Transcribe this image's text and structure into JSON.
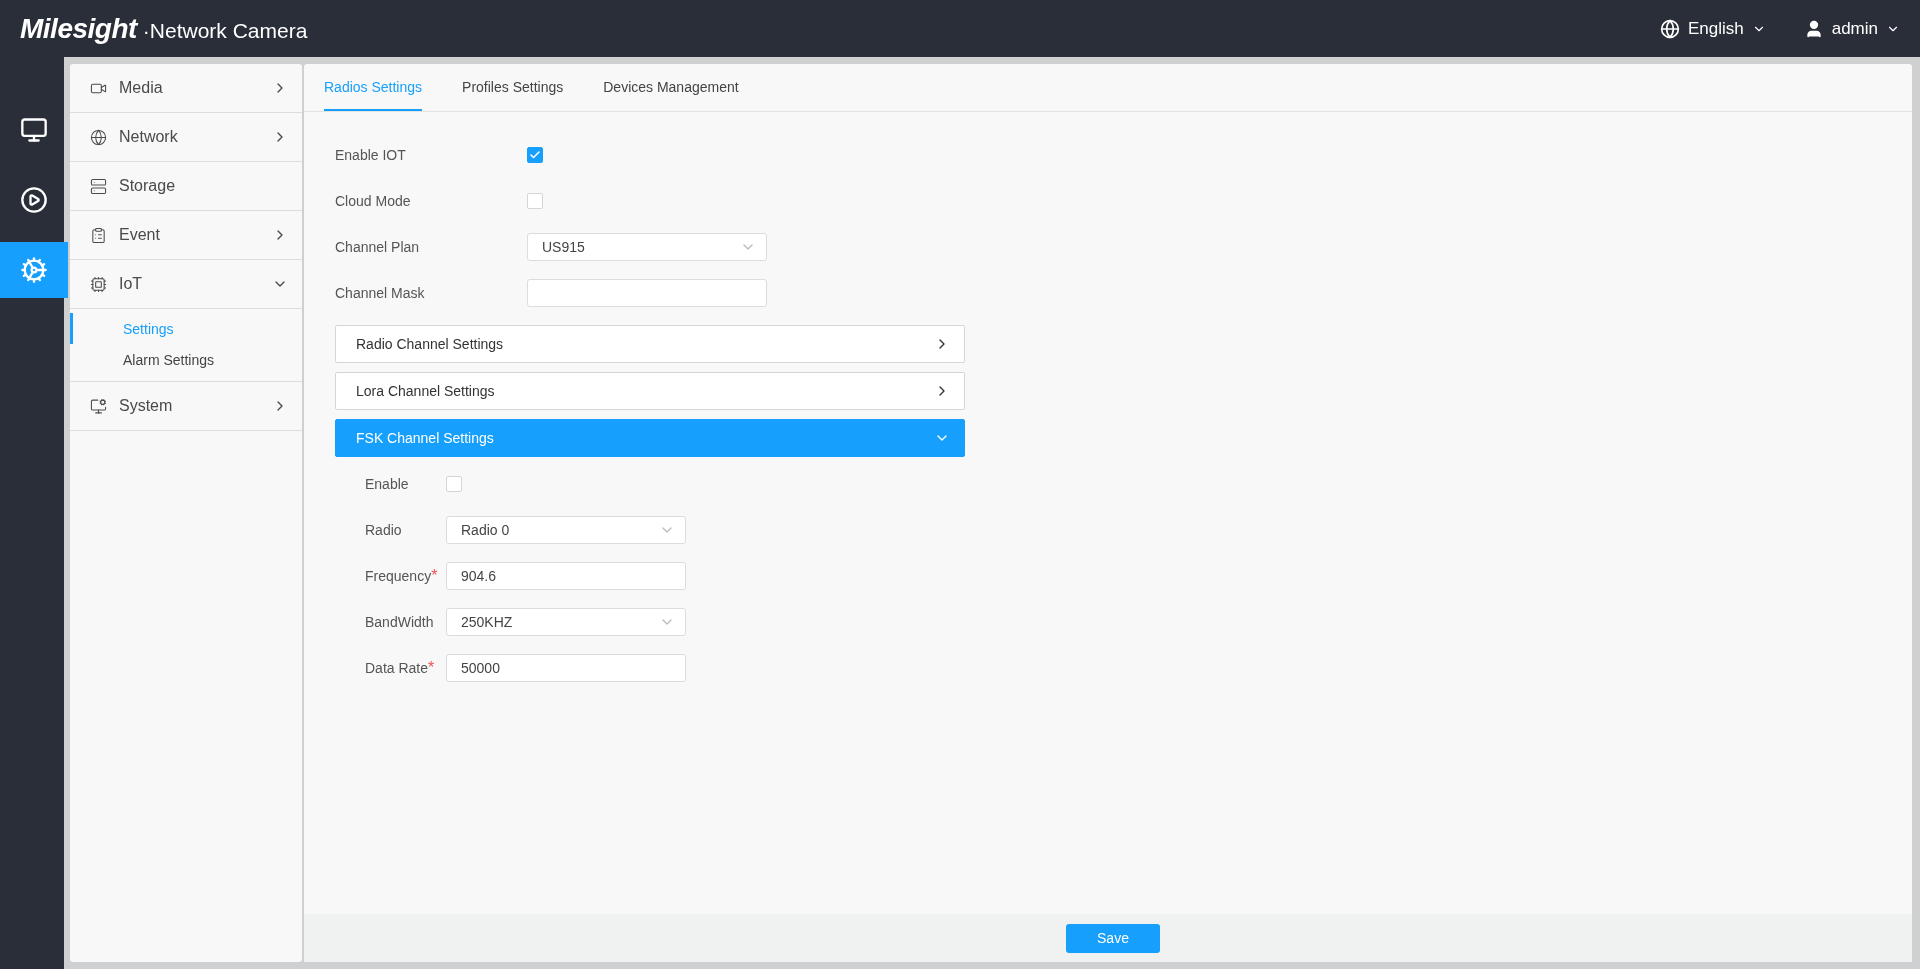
{
  "header": {
    "brand": "Milesight",
    "product": "·Network Camera",
    "language": "English",
    "user": "admin"
  },
  "rail": [
    {
      "kind": "live",
      "selected": false
    },
    {
      "kind": "playback",
      "selected": false
    },
    {
      "kind": "settings",
      "selected": true
    }
  ],
  "sidebar": {
    "items": [
      {
        "kind": "media",
        "label": "Media",
        "expanded": false,
        "has_arrow": true
      },
      {
        "kind": "network",
        "label": "Network",
        "expanded": false,
        "has_arrow": true
      },
      {
        "kind": "storage",
        "label": "Storage",
        "expanded": false,
        "has_arrow": false
      },
      {
        "kind": "event",
        "label": "Event",
        "expanded": false,
        "has_arrow": true
      },
      {
        "kind": "iot",
        "label": "IoT",
        "expanded": true,
        "has_arrow": true,
        "children": [
          {
            "label": "Settings",
            "selected": true
          },
          {
            "label": "Alarm Settings",
            "selected": false
          }
        ]
      },
      {
        "kind": "system",
        "label": "System",
        "expanded": false,
        "has_arrow": true
      }
    ]
  },
  "tabs": [
    {
      "label": "Radios Settings",
      "selected": true
    },
    {
      "label": "Profiles Settings",
      "selected": false
    },
    {
      "label": "Devices Management",
      "selected": false
    }
  ],
  "form": [
    {
      "kind": "checkbox",
      "label": "Enable IOT",
      "checked": true
    },
    {
      "kind": "checkbox",
      "label": "Cloud Mode",
      "checked": false
    },
    {
      "kind": "select",
      "label": "Channel Plan",
      "value": "US915"
    },
    {
      "kind": "text",
      "label": "Channel Mask"
    }
  ],
  "sections": [
    {
      "title": "Radio Channel Settings",
      "expanded": false
    },
    {
      "title": "Lora Channel Settings",
      "expanded": false
    },
    {
      "title": "FSK Channel Settings",
      "expanded": true,
      "fields": [
        {
          "kind": "checkbox",
          "label": "Enable",
          "checked": false
        },
        {
          "kind": "select",
          "label": "Radio",
          "value": "Radio 0"
        },
        {
          "kind": "text",
          "label": "Frequency",
          "required_mark": "*",
          "value": "904.6"
        },
        {
          "kind": "select",
          "label": "BandWidth",
          "value": "250KHZ"
        },
        {
          "kind": "text",
          "label": "Data Rate",
          "required_mark": "*",
          "value": "50000"
        }
      ]
    }
  ],
  "save_button": "Save"
}
